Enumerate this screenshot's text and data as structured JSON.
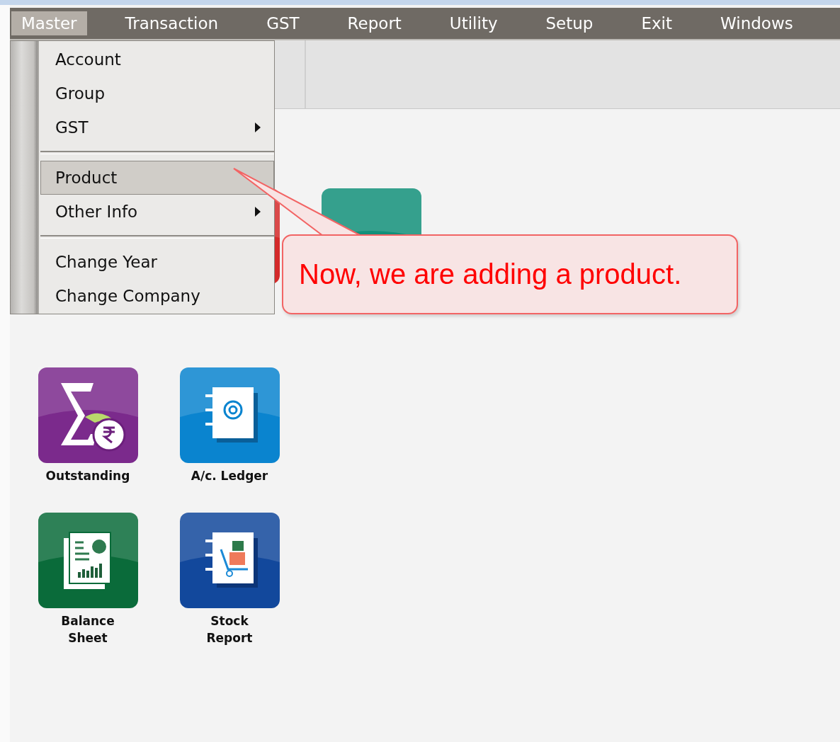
{
  "menu_bar": [
    {
      "label": "Master",
      "selected": true
    },
    {
      "label": "Transaction",
      "selected": false
    },
    {
      "label": "GST",
      "selected": false
    },
    {
      "label": "Report",
      "selected": false
    },
    {
      "label": "Utility",
      "selected": false
    },
    {
      "label": "Setup",
      "selected": false
    },
    {
      "label": "Exit",
      "selected": false
    },
    {
      "label": "Windows",
      "selected": false
    }
  ],
  "dropdown": {
    "items": [
      {
        "kind": "item",
        "label": "Account",
        "submenu": false,
        "selected": false
      },
      {
        "kind": "item",
        "label": "Group",
        "submenu": false,
        "selected": false
      },
      {
        "kind": "item",
        "label": "GST",
        "submenu": true,
        "selected": false
      },
      {
        "kind": "separator"
      },
      {
        "kind": "item",
        "label": "Product",
        "submenu": false,
        "selected": true
      },
      {
        "kind": "item",
        "label": "Other Info",
        "submenu": true,
        "selected": false
      },
      {
        "kind": "separator"
      },
      {
        "kind": "item",
        "label": "Change Year",
        "submenu": false,
        "selected": false
      },
      {
        "kind": "item",
        "label": "Change Company",
        "submenu": false,
        "selected": false
      }
    ]
  },
  "tiles": [
    {
      "kind": "outstanding",
      "label": "Outstanding"
    },
    {
      "kind": "ledger",
      "label": "A/c. Ledger"
    },
    {
      "kind": "balance",
      "label": "Balance Sheet"
    },
    {
      "kind": "stock",
      "label": "Stock Report"
    }
  ],
  "callout": {
    "text": "Now, we are adding a product."
  }
}
